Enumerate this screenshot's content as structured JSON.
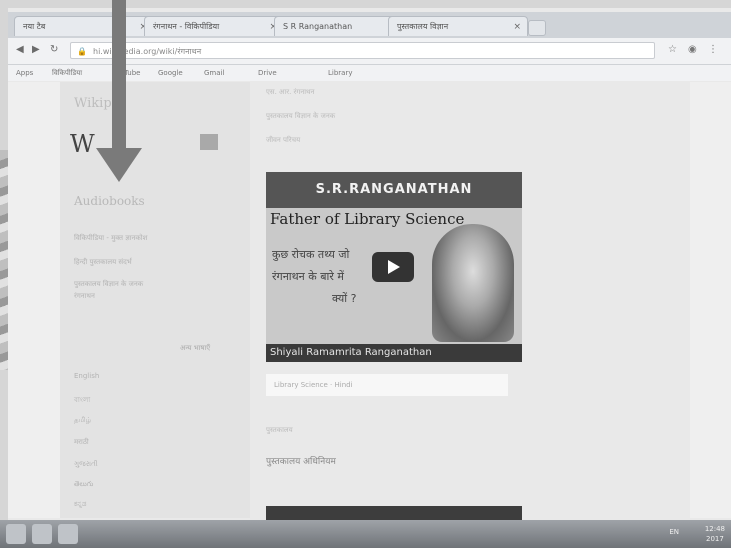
{
  "browser": {
    "tabs": [
      {
        "label": "नया टैब"
      },
      {
        "label": "रंगनाथन - विकिपीडिया"
      },
      {
        "label": "S R Ranganathan"
      },
      {
        "label": "पुस्तकालय विज्ञान"
      }
    ],
    "address": "hi.wikipedia.org/wiki/रंगनाथन",
    "bookmarks": [
      "Apps",
      "विकिपीडिया",
      "YouTube",
      "Google",
      "Gmail",
      "Drive",
      "Library"
    ]
  },
  "sidebar": {
    "wiki_text": "Wikip",
    "logo": "W",
    "heading": "Audiobooks",
    "links_top": [
      "विकिपीडिया - मुक्त ज्ञानकोश",
      "हिन्दी पुस्तकालय संदर्भ",
      "पुस्तकालय विज्ञान के जनक",
      "रंगनाथन"
    ],
    "sub_heading": "अन्य भाषाएँ",
    "links_bottom": [
      "English",
      "বাংলা",
      "தமிழ்",
      "मराठी",
      "ગુજરાતી",
      "తెలుగు",
      "ಕನ್ನಡ"
    ]
  },
  "main": {
    "top_lines": [
      "एस. आर. रंगनाथन",
      "पुस्तकालय विज्ञान के जनक",
      "जीवन परिचय"
    ],
    "video": {
      "banner": "S.R.RANGANATHAN",
      "title": "Father of Library Science",
      "hindi_line_1": "कुछ रोचक तथ्य जो",
      "hindi_line_2": "रंगनाथन के बारे में",
      "hindi_line_3": "क्यों ?",
      "caption": "Shiyali Ramamrita Ranganathan"
    },
    "pill_text": "Library Science · Hindi",
    "mid_label": "पुस्तकालय",
    "footer_text": "पुस्तकालय अधिनियम"
  },
  "taskbar": {
    "tray": "EN",
    "time": "12:48",
    "date": "2017"
  }
}
